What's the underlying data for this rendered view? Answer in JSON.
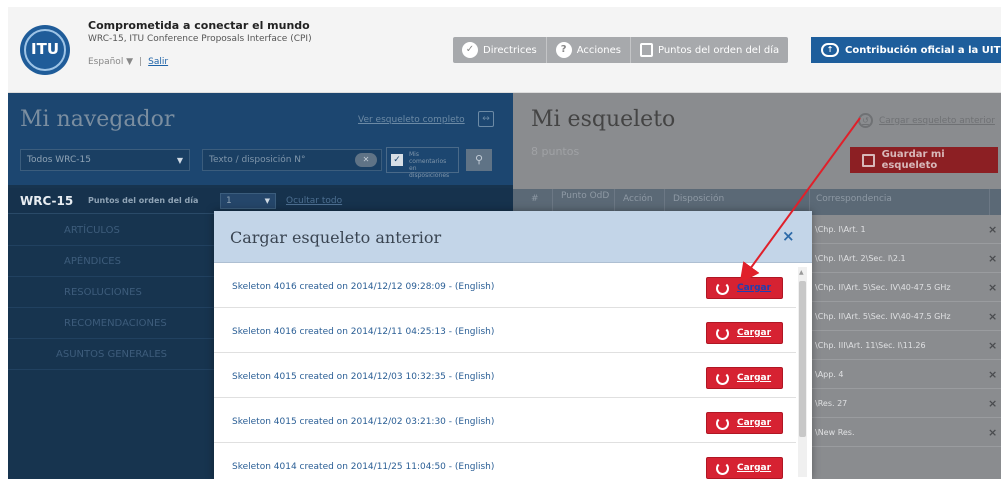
{
  "header": {
    "title": "Comprometida a conectar el mundo",
    "subtitle": "WRC-15, ITU Conference Proposals Interface (CPI)",
    "language": "Español ▼",
    "separator": "|",
    "logout": "Salir",
    "logo_text": "ITU",
    "nav_buttons": [
      {
        "label": "Directrices",
        "icon": "check-circle-icon"
      },
      {
        "label": "Acciones",
        "icon": "question-circle-icon"
      },
      {
        "label": "Puntos del orden del día",
        "icon": "document-icon"
      }
    ],
    "official_button": "Contribución oficial a la UIT"
  },
  "navigator": {
    "title": "Mi navegador",
    "full_skeleton_link": "Ver esqueleto completo",
    "filter_select": "Todos WRC-15",
    "text_placeholder": "Texto / disposición N°",
    "checkbox_label": "Mis comentarios en disposiciones",
    "wrc_label": "WRC-15",
    "agenda_label": "Puntos del orden del día",
    "agenda_select": "1",
    "hide_all": "Ocultar todo",
    "menu_items": [
      "ARTÍCULOS",
      "APÉNDICES",
      "RESOLUCIONES",
      "RECOMENDACIONES",
      "ASUNTOS GENERALES"
    ]
  },
  "skeleton": {
    "title": "Mi esqueleto",
    "points": "8 puntos",
    "load_previous_link": "Cargar esqueleto anterior",
    "save_button": "Guardar mi esqueleto",
    "columns": [
      "#",
      "Punto OdD",
      "Acción",
      "Disposición",
      "Correspondencia"
    ],
    "rows": [
      "\\Chp. I\\Art. 1",
      "\\Chp. I\\Art. 2\\Sec. I\\2.1",
      "\\Chp. II\\Art. 5\\Sec. IV\\40-47.5 GHz",
      "\\Chp. II\\Art. 5\\Sec. IV\\40-47.5 GHz",
      "\\Chp. III\\Art. 11\\Sec. I\\11.26",
      "\\App. 4",
      "\\Res. 27",
      "\\New Res."
    ],
    "delete_mark": "×"
  },
  "modal": {
    "title": "Cargar esqueleto anterior",
    "close": "×",
    "load_label": "Cargar",
    "items": [
      "Skeleton 4016 created on 2014/12/12 09:28:09 - (English)",
      "Skeleton 4016 created on 2014/12/11 04:25:13 - (English)",
      "Skeleton 4015 created on 2014/12/03 10:32:35 - (English)",
      "Skeleton 4015 created on 2014/12/02 03:21:30 - (English)",
      "Skeleton 4014 created on 2014/11/25 11:04:50 - (English)"
    ]
  },
  "colors": {
    "accent_red": "#d62232",
    "brand_blue": "#1e5e9c",
    "annotation_arrow": "#e0202a"
  }
}
